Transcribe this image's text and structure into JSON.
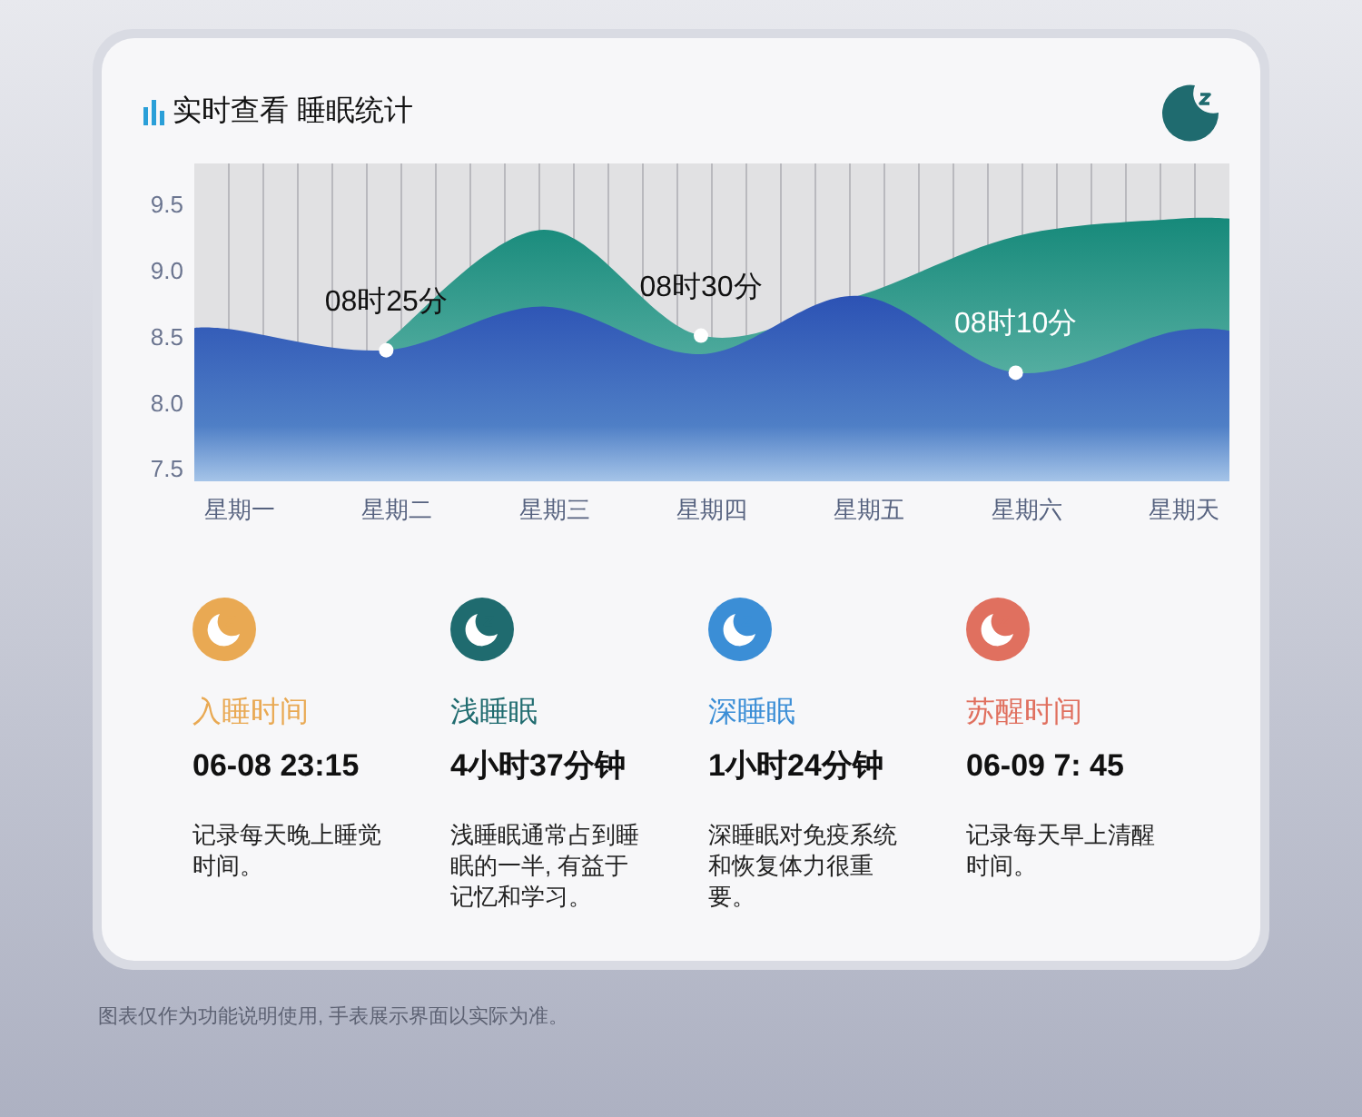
{
  "header": {
    "title": "实时查看 睡眠统计"
  },
  "chart_data": {
    "type": "area",
    "categories": [
      "星期一",
      "星期二",
      "星期三",
      "星期四",
      "星期五",
      "星期六",
      "星期天"
    ],
    "series": [
      {
        "color": "#16897a",
        "values": [
          null,
          8.45,
          9.3,
          8.5,
          8.8,
          9.25,
          9.38
        ]
      },
      {
        "color": "#2c52b4",
        "values": [
          8.55,
          8.39,
          8.72,
          8.36,
          8.8,
          8.22,
          8.53
        ]
      }
    ],
    "ylim": [
      7.4,
      9.8
    ],
    "yticks": [
      {
        "value": 7.5,
        "label": "7.5"
      },
      {
        "value": 8,
        "label": "8.0"
      },
      {
        "value": 8.5,
        "label": "8.5"
      },
      {
        "value": 9,
        "label": "9.0"
      },
      {
        "value": 9.5,
        "label": "9.5"
      }
    ],
    "grid": true,
    "annotations": [
      {
        "x": "星期二",
        "y": 8.39,
        "text": "08时25分"
      },
      {
        "x": "星期四",
        "y": 8.5,
        "text": "08时30分"
      },
      {
        "x": "星期六",
        "y": 8.22,
        "text": "08时10分"
      }
    ]
  },
  "stats": [
    {
      "label": "入睡时间",
      "value": "06-08 23:15",
      "description": "记录每天晚上睡觉时间。",
      "color": "#e9a953"
    },
    {
      "label": "浅睡眠",
      "value": "4小时37分钟",
      "description": "浅睡眠通常占到睡眠的一半, 有益于记忆和学习。",
      "color": "#1f6b6f"
    },
    {
      "label": "深睡眠",
      "value": "1小时24分钟",
      "description": "深睡眠对免疫系统和恢复体力很重要。",
      "color": "#3b8ed6"
    },
    {
      "label": "苏醒时间",
      "value": "06-09 7: 45",
      "description": "记录每天早上清醒时间。",
      "color": "#e0705f"
    }
  ],
  "footer": {
    "note": "图表仅作为功能说明使用, 手表展示界面以实际为准。"
  }
}
